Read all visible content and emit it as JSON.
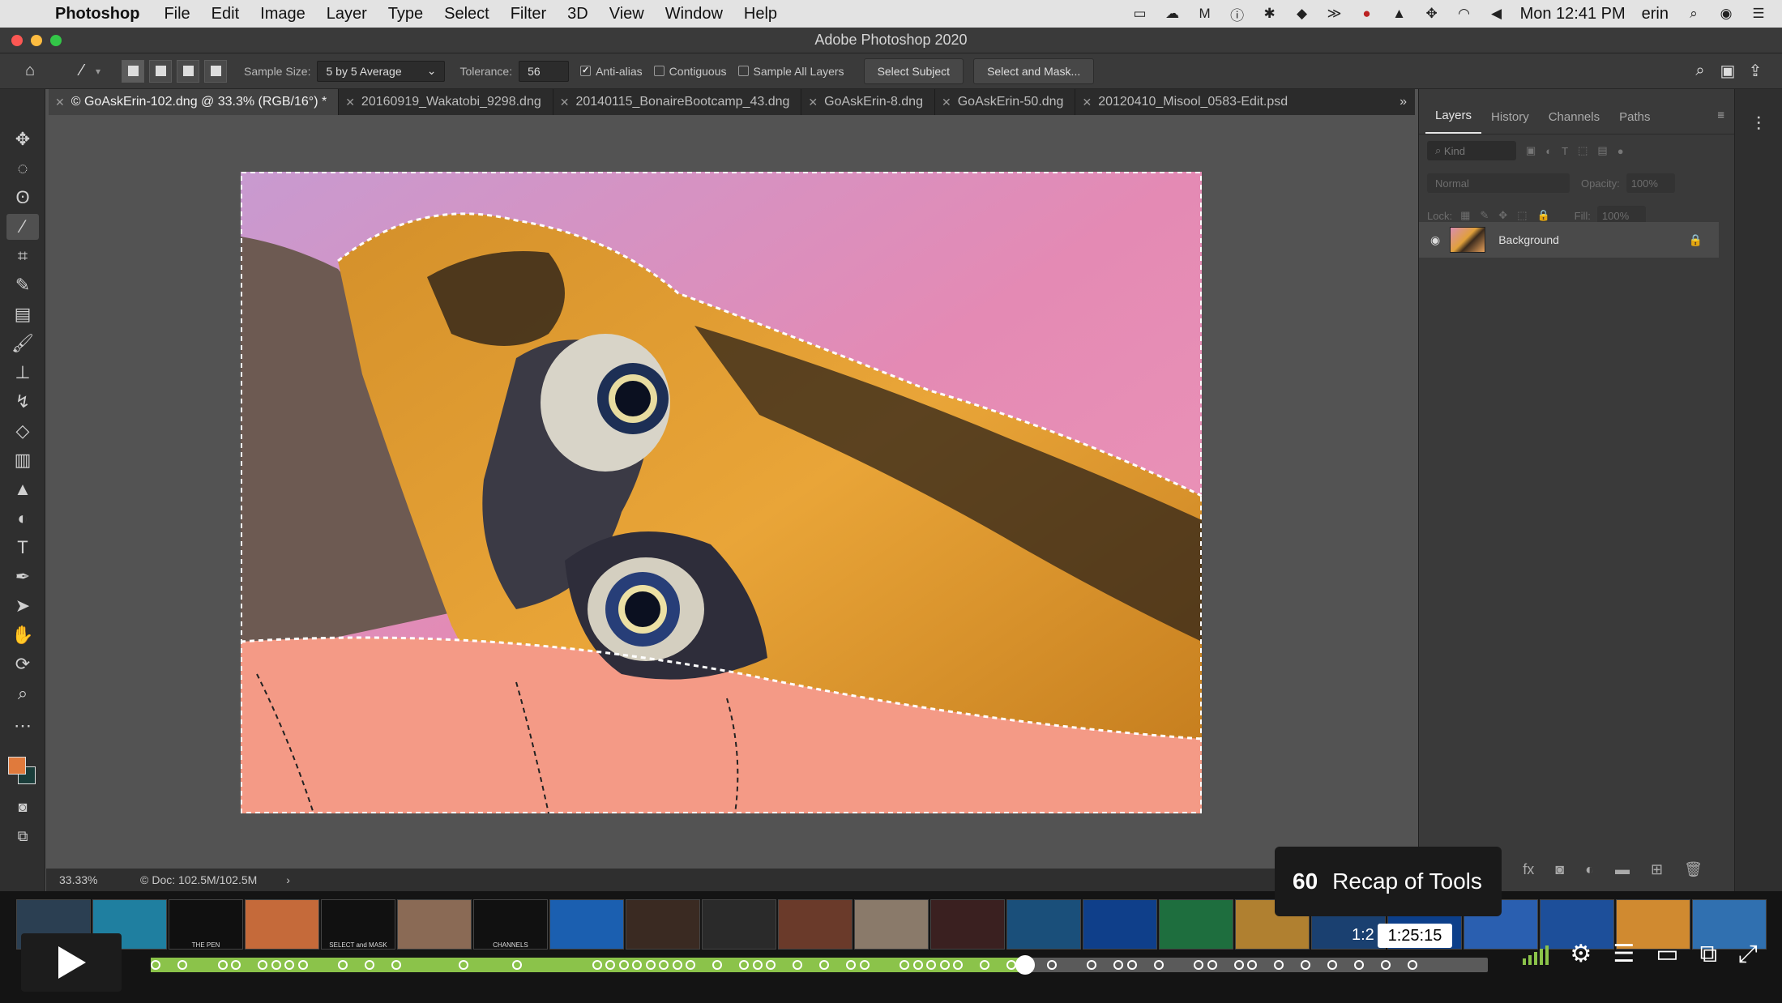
{
  "menubar": {
    "apple": "",
    "items": [
      "Photoshop",
      "File",
      "Edit",
      "Image",
      "Layer",
      "Type",
      "Select",
      "Filter",
      "3D",
      "View",
      "Window",
      "Help"
    ],
    "clock": "Mon 12:41 PM",
    "user": "erin"
  },
  "window": {
    "title": "Adobe Photoshop 2020"
  },
  "options": {
    "sample_size_label": "Sample Size:",
    "sample_size_value": "5 by 5 Average",
    "tolerance_label": "Tolerance:",
    "tolerance_value": "56",
    "anti_alias": "Anti-alias",
    "contiguous": "Contiguous",
    "sample_all_layers": "Sample All Layers",
    "select_subject": "Select Subject",
    "select_and_mask": "Select and Mask..."
  },
  "tabs": [
    "© GoAskErin-102.dng @ 33.3% (RGB/16°) *",
    "20160919_Wakatobi_9298.dng",
    "20140115_BonaireBootcamp_43.dng",
    "GoAskErin-8.dng",
    "GoAskErin-50.dng",
    "20120410_Misool_0583-Edit.psd"
  ],
  "status": {
    "zoom": "33.33%",
    "doc": "Doc: 102.5M/102.5M"
  },
  "panel": {
    "tabs": [
      "Layers",
      "History",
      "Channels",
      "Paths"
    ],
    "kind": "Kind",
    "blend": "Normal",
    "opacity_label": "Opacity:",
    "opacity_value": "100%",
    "lock_label": "Lock:",
    "fill_label": "Fill:",
    "fill_value": "100%",
    "layer_name": "Background"
  },
  "player": {
    "chapter_number": "60",
    "chapter_title": "Recap of Tools",
    "time": "1:25:15",
    "time_partial": "1:2",
    "progress": 0.654,
    "thumb_captions": [
      "",
      "",
      "THE PEN",
      "",
      "SELECT and MASK",
      "",
      "CHANNELS",
      "",
      "",
      "",
      "",
      "",
      "",
      "",
      "",
      "",
      "",
      "",
      "",
      "",
      "",
      "",
      "",
      ""
    ]
  },
  "colors": {
    "accent": "#8bc34a",
    "foreground": "#e07a3c",
    "background": "#1a3d3a"
  }
}
